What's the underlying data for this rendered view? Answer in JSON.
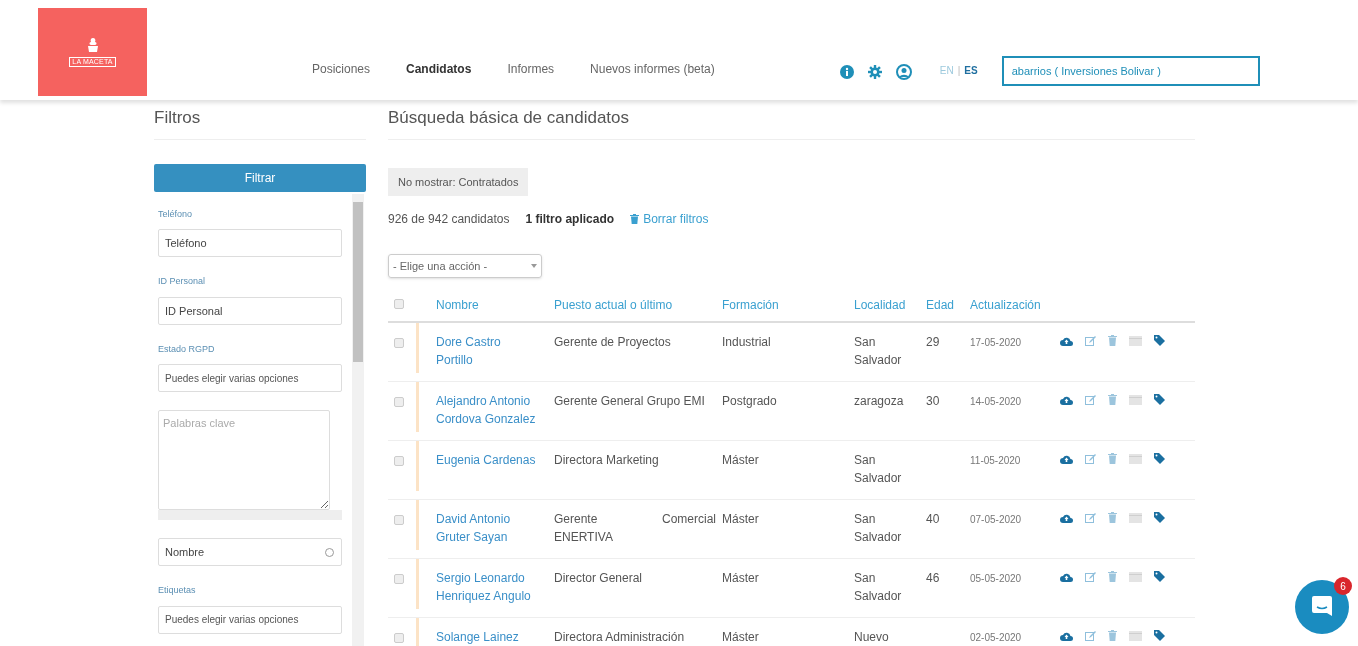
{
  "logo": {
    "text": "LA MACETA"
  },
  "nav": [
    {
      "label": "Posiciones",
      "selected": false
    },
    {
      "label": "Candidatos",
      "selected": true
    },
    {
      "label": "Informes",
      "selected": false
    },
    {
      "label": "Nuevos informes (beta)",
      "selected": false
    }
  ],
  "languages": [
    {
      "label": "EN",
      "selected": false
    },
    {
      "label": "ES",
      "selected": true
    }
  ],
  "language_separator": "|",
  "account": {
    "value": "abarrios ( Inversiones Bolivar )"
  },
  "sidebar": {
    "title": "Filtros",
    "button": "Filtrar",
    "fields": [
      {
        "kind": "input",
        "label": "Teléfono",
        "placeholder": "Teléfono"
      },
      {
        "kind": "input",
        "label": "ID Personal",
        "placeholder": "ID Personal"
      },
      {
        "kind": "multiselect",
        "label": "Estado RGPD",
        "placeholder": "Puedes elegir varias opciones"
      },
      {
        "kind": "textarea",
        "placeholder": "Palabras clave"
      },
      {
        "kind": "search",
        "placeholder": "Nombre"
      },
      {
        "kind": "multiselect",
        "label": "Etiquetas",
        "placeholder": "Puedes elegir varias opciones"
      }
    ]
  },
  "main": {
    "title": "Búsqueda básica de candidatos",
    "chip": "No mostrar: Contratados",
    "count": "926 de 942 candidatos",
    "filters_applied": "1 filtro aplicado",
    "clear_filters": "Borrar filtros",
    "action_select": {
      "value": "- Elige una acción -"
    }
  },
  "table": {
    "header_checked": false,
    "columns": [
      "Nombre",
      "Puesto actual o último",
      "Formación",
      "Localidad",
      "Edad",
      "Actualización"
    ],
    "rows": [
      {
        "checked": false,
        "name": "Dore Castro Portillo",
        "position": "Gerente de Proyectos",
        "education": "Industrial",
        "location": "San Salvador",
        "age": "29",
        "updated": "17-05-2020"
      },
      {
        "checked": false,
        "name": "Alejandro Antonio Cordova Gonzalez",
        "position": "Gerente General Grupo EMI",
        "education": "Postgrado",
        "location": "zaragoza",
        "age": "30",
        "updated": "14-05-2020"
      },
      {
        "checked": false,
        "name": "Eugenia Cardenas",
        "position": "Directora Marketing",
        "education": "Máster",
        "location": "San Salvador",
        "updated": "11-05-2020"
      },
      {
        "checked": false,
        "name": "David Antonio Gruter Sayan",
        "position": "Gerente Comercial ENERTIVA",
        "education": "Máster",
        "location": "San Salvador",
        "age": "40",
        "updated": "07-05-2020"
      },
      {
        "checked": false,
        "name": "Sergio Leonardo Henriquez Angulo",
        "position": "Director General",
        "education": "Máster",
        "location": "San Salvador",
        "age": "46",
        "updated": "05-05-2020"
      },
      {
        "checked": false,
        "name": "Solange Lainez",
        "position": "Directora Administración",
        "education": "Máster",
        "location": "Nuevo",
        "updated": "02-05-2020"
      }
    ]
  },
  "chat": {
    "badge": "6"
  }
}
